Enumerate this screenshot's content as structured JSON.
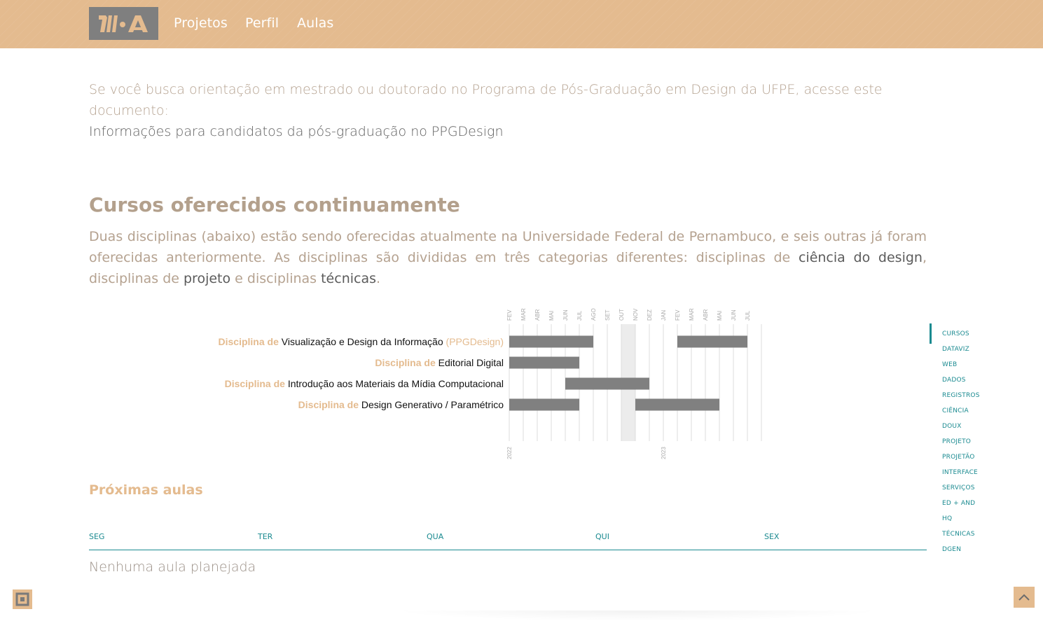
{
  "nav": {
    "logo_text": "RMA",
    "links": [
      "Projetos",
      "Perfil",
      "Aulas"
    ]
  },
  "intro": {
    "text": "Se você busca orientação em mestrado ou doutorado no Programa de Pós-Graduação em Design da UFPE, acesse este documento:",
    "link": "Informações para candidatos da pós-graduação no PPGDesign"
  },
  "courses": {
    "title": "Cursos oferecidos continuamente",
    "desc_part1": "Duas disciplinas (abaixo) estão sendo oferecidas atualmente na Universidade Federal de Pernambuco, e seis outras já foram oferecidas anteriormente. As disciplinas são divididas em três categorias diferentes: disciplinas de ",
    "desc_link1": "ciência do design",
    "desc_part2": ", disciplinas de ",
    "desc_link2": "projeto",
    "desc_part3": " e disciplinas ",
    "desc_link3": "técnicas",
    "desc_part4": "."
  },
  "chart_data": {
    "type": "gantt",
    "months": [
      "FEV",
      "MAR",
      "ABR",
      "MAI",
      "JUN",
      "JUL",
      "AGO",
      "SET",
      "OUT",
      "NOV",
      "DEZ",
      "JAN",
      "FEV",
      "MAR",
      "ABR",
      "MAI",
      "JUN",
      "JUL"
    ],
    "years": [
      {
        "label": "2022",
        "month_index": 0
      },
      {
        "label": "2023",
        "month_index": 11
      }
    ],
    "highlight_month_index": 8,
    "rows": [
      {
        "prefix": "Disciplina de ",
        "name": "Visualização e Design da Informação",
        "suffix": " (PPGDesign)",
        "bars": [
          [
            0,
            6
          ],
          [
            12,
            17
          ]
        ]
      },
      {
        "prefix": "Disciplina de ",
        "name": "Editorial Digital",
        "suffix": "",
        "bars": [
          [
            0,
            5
          ]
        ]
      },
      {
        "prefix": "Disciplina de ",
        "name": "Introdução aos Materiais da Mídia Computacional",
        "suffix": "",
        "bars": [
          [
            4,
            10
          ]
        ]
      },
      {
        "prefix": "Disciplina de ",
        "name": "Design Generativo / Paramétrico",
        "suffix": "",
        "bars": [
          [
            0,
            5
          ],
          [
            9,
            15
          ]
        ]
      }
    ],
    "colors": {
      "bar": "#808080",
      "prefix": "#e4bb8f",
      "name": "#111111",
      "grid": "#dddddd",
      "highlight": "#ececec",
      "axis_text": "#aaaaaa"
    }
  },
  "schedule": {
    "title": "Próximas aulas",
    "days": [
      "SEG",
      "TER",
      "QUA",
      "QUI",
      "SEX"
    ],
    "empty_text": "Nenhuma aula planejada"
  },
  "toc": {
    "items": [
      "CURSOS",
      "DATAVIZ",
      "WEB",
      "DADOS",
      "REGISTROS",
      "CIÊNCIA",
      "DOUX",
      "PROJETO",
      "PROJETÃO",
      "INTERFACE",
      "SERVIÇOS",
      "ED + AND",
      "HQ",
      "TÉCNICAS",
      "DGEN"
    ],
    "active_index": 0
  },
  "colors": {
    "accent": "#e4bb8f",
    "teal": "#1a8a90",
    "muted": "#b5a290"
  }
}
